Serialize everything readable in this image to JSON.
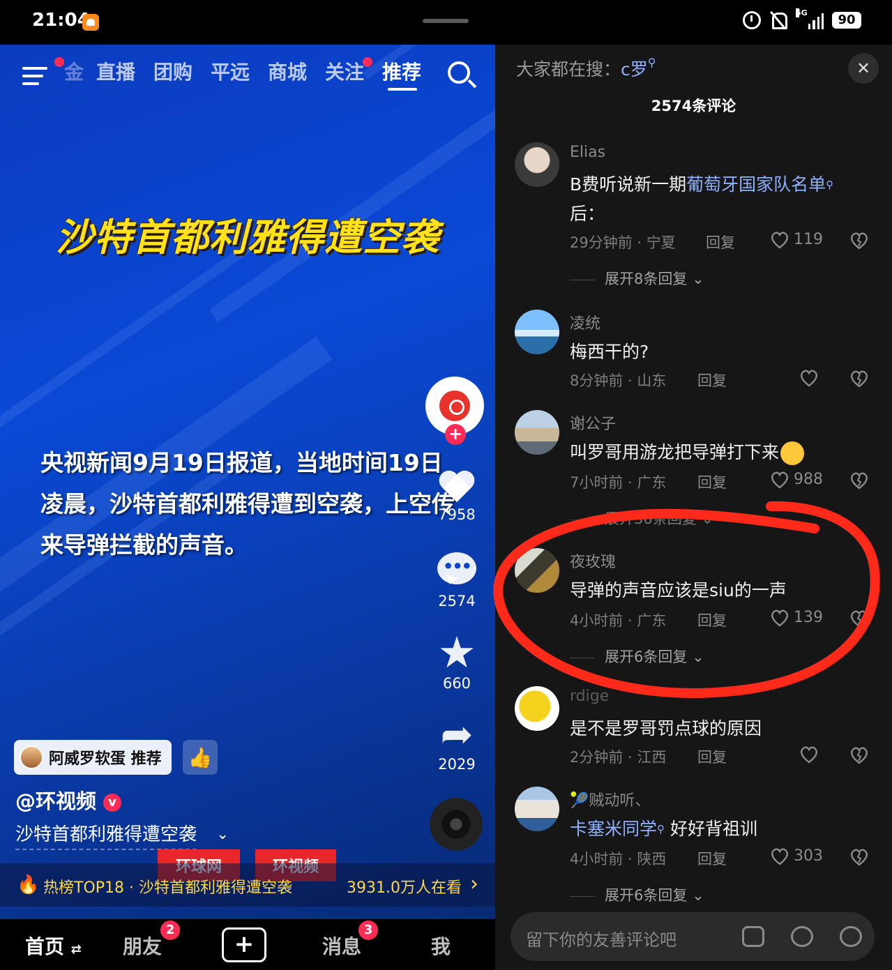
{
  "status_bar": {
    "time": "21:04",
    "network": "5G",
    "battery": "90"
  },
  "video": {
    "nav": [
      "直播",
      "团购",
      "平远",
      "商城",
      "关注",
      "推荐"
    ],
    "nav_cut": "金",
    "headline": "沙特首都利雅得遭空袭",
    "subtitle": "央视新闻9月19日报道，当地时间19日凌晨，沙特首都利雅得遭到空袭，上空传来导弹拦截的声音。",
    "likes": "7958",
    "comments": "2574",
    "favorites": "660",
    "shares": "2029",
    "recommend_chip": "阿威罗软蛋 推荐",
    "author": "@环视频",
    "caption": "沙特首都利雅得遭空袭",
    "watermarks": [
      "环球网",
      "环视频"
    ],
    "hot_text": "热榜TOP18 · 沙特首都利雅得遭空袭",
    "hot_views": "3931.0万人在看",
    "tabs": {
      "home": "首页",
      "friends": "朋友",
      "friends_badge": "2",
      "messages": "消息",
      "messages_badge": "3",
      "me": "我"
    }
  },
  "comments_panel": {
    "search_prefix": "大家都在搜：",
    "search_keyword": "c罗",
    "count": "2574条评论",
    "reply_label": "回复",
    "items": [
      {
        "name": "Elias",
        "text_plain": "B费听说新一期",
        "text_link": "葡萄牙国家队名单",
        "text_after": "后：",
        "time": "29分钟前 · 宁夏",
        "likes": "119",
        "expand": "展开8条回复"
      },
      {
        "name": "凌统",
        "text_plain": "梅西干的?",
        "time": "8分钟前 · 山东",
        "likes": ""
      },
      {
        "name": "谢公子",
        "text_plain": "叫罗哥用游龙把导弹打下来",
        "time": "7小时前 · 广东",
        "likes": "988",
        "expand": "展开30条回复"
      },
      {
        "name": "夜玫瑰",
        "text_plain": "导弹的声音应该是siu的一声",
        "time": "4小时前 · 广东",
        "likes": "139",
        "expand": "展开6条回复"
      },
      {
        "name": "rdige",
        "text_plain": "是不是罗哥罚点球的原因",
        "time": "2分钟前 · 江西",
        "likes": ""
      },
      {
        "name": "🎾贼动听、",
        "text_link": "卡塞米同学",
        "text_after": " 好好背祖训",
        "time": "4小时前 · 陕西",
        "likes": "303",
        "expand": "展开6条回复"
      }
    ],
    "compose_placeholder": "留下你的友善评论吧"
  },
  "colors": {
    "video_bg": "#0a49d6",
    "headline": "#ffe21a",
    "annotation": "#ff2a1a",
    "link": "#8fb0ff",
    "hot": "#ffd84a"
  }
}
